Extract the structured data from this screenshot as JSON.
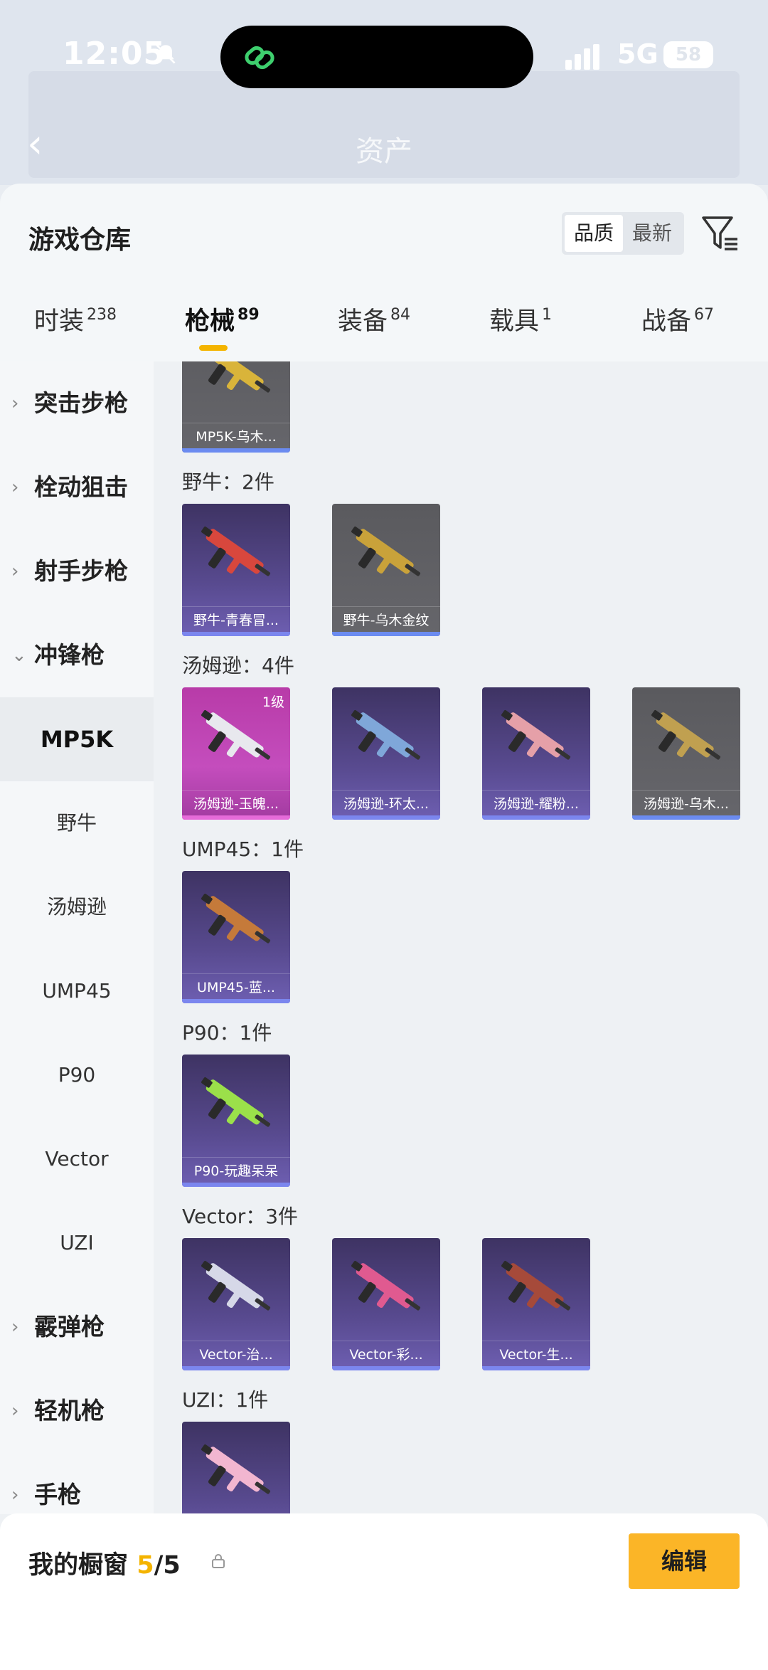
{
  "status": {
    "time": "12:05",
    "network": "5G",
    "battery": "58"
  },
  "header": {
    "asset_label": "资产"
  },
  "sheet": {
    "title": "游戏仓库",
    "sort": {
      "quality": "品质",
      "newest": "最新"
    }
  },
  "tabs": [
    {
      "label": "时装",
      "count": "238"
    },
    {
      "label": "枪械",
      "count": "89"
    },
    {
      "label": "装备",
      "count": "84"
    },
    {
      "label": "载具",
      "count": "1"
    },
    {
      "label": "战备",
      "count": "67"
    }
  ],
  "sidenav": {
    "items": [
      {
        "label": "突击步枪"
      },
      {
        "label": "栓动狙击"
      },
      {
        "label": "射手步枪"
      },
      {
        "label": "冲锋枪"
      },
      {
        "label": "MP5K"
      },
      {
        "label": "野牛"
      },
      {
        "label": "汤姆逊"
      },
      {
        "label": "UMP45"
      },
      {
        "label": "P90"
      },
      {
        "label": "Vector"
      },
      {
        "label": "UZI"
      },
      {
        "label": "霰弹枪"
      },
      {
        "label": "轻机枪"
      },
      {
        "label": "手枪"
      }
    ]
  },
  "groups": [
    {
      "title": "",
      "items": [
        {
          "name": "MP5K-乌木...",
          "style": "gold"
        }
      ]
    },
    {
      "title": "野牛：2件",
      "items": [
        {
          "name": "野牛-青春冒...",
          "style": "purple"
        },
        {
          "name": "野牛-乌木金纹",
          "style": "gold"
        }
      ]
    },
    {
      "title": "汤姆逊：4件",
      "items": [
        {
          "name": "汤姆逊-玉魄...",
          "style": "pink",
          "level": "1级"
        },
        {
          "name": "汤姆逊-环太...",
          "style": "purple"
        },
        {
          "name": "汤姆逊-耀粉...",
          "style": "purple"
        },
        {
          "name": "汤姆逊-乌木...",
          "style": "gold"
        }
      ]
    },
    {
      "title": "UMP45：1件",
      "items": [
        {
          "name": "UMP45-蓝...",
          "style": "purple"
        }
      ]
    },
    {
      "title": "P90：1件",
      "items": [
        {
          "name": "P90-玩趣呆呆",
          "style": "purple"
        }
      ]
    },
    {
      "title": "Vector：3件",
      "items": [
        {
          "name": "Vector-治...",
          "style": "purple"
        },
        {
          "name": "Vector-彩...",
          "style": "purple"
        },
        {
          "name": "Vector-生...",
          "style": "purple"
        }
      ]
    },
    {
      "title": "UZI：1件",
      "items": [
        {
          "name": "",
          "style": "purple"
        }
      ]
    }
  ],
  "bottom": {
    "label": "我的橱窗",
    "current": "5",
    "total": "/5",
    "edit": "编辑"
  },
  "icons": {
    "filter": "filter-icon",
    "share": "share-out-icon",
    "lock": "lock-icon",
    "back": "back-arrow-icon"
  },
  "colors": {
    "accent": "#f4b400",
    "button": "#fbb527"
  }
}
